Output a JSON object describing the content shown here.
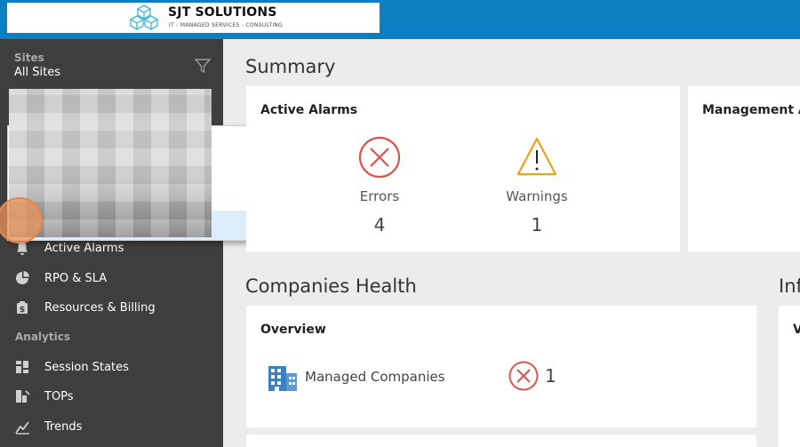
{
  "logo": {
    "name": "SJT SOLUTIONS",
    "tagline": "IT - MANAGED SERVICES - CONSULTING"
  },
  "sidebar": {
    "sites_label": "Sites",
    "sites_value": "All Sites",
    "items": [
      {
        "label": "Active Alarms",
        "icon": "bell-icon"
      },
      {
        "label": "RPO & SLA",
        "icon": "pie-chart-icon"
      },
      {
        "label": "Resources & Billing",
        "icon": "billing-icon"
      }
    ],
    "analytics_label": "Analytics",
    "analytics_items": [
      {
        "label": "Session States",
        "icon": "dashboard-grid-icon"
      },
      {
        "label": "TOPs",
        "icon": "tops-icon"
      },
      {
        "label": "Trends",
        "icon": "trends-icon"
      }
    ]
  },
  "summary": {
    "title": "Summary",
    "active_alarms": {
      "title": "Active Alarms",
      "errors_label": "Errors",
      "errors_value": "4",
      "warnings_label": "Warnings",
      "warnings_value": "1"
    },
    "management_title": "Management A"
  },
  "companies_health": {
    "title": "Companies Health",
    "overview": {
      "title": "Overview",
      "item_label": "Managed Companies",
      "item_value": "1"
    }
  },
  "right_heading": "Inf",
  "colors": {
    "topbar": "#0a7fc1",
    "error": "#d9534f",
    "warning": "#e8a317",
    "sidebar": "#3e3e3e"
  }
}
